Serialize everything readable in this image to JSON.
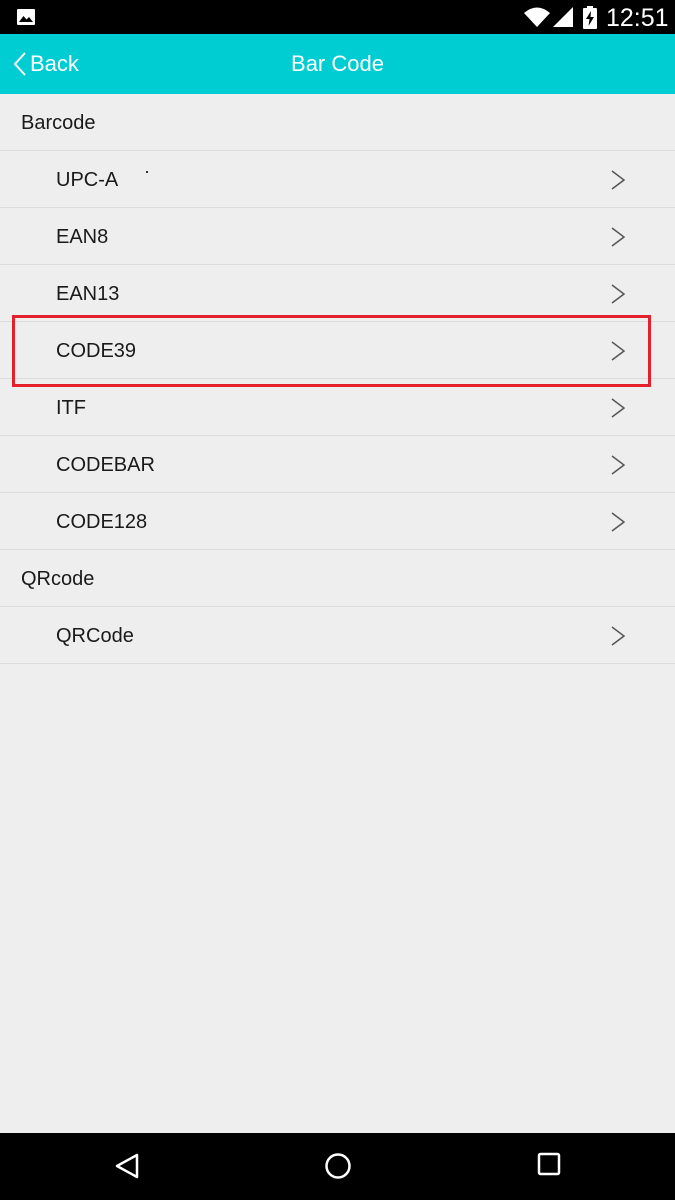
{
  "status_bar": {
    "time": "12:51",
    "icons": [
      "image-notification-icon",
      "wifi-icon",
      "cell-signal-icon",
      "battery-charging-icon"
    ]
  },
  "app_bar": {
    "back_label": "Back",
    "title": "Bar Code",
    "background_color": "#00cdd2"
  },
  "sections": [
    {
      "header": "Barcode",
      "items": [
        "UPC-A",
        "EAN8",
        "EAN13",
        "CODE39",
        "ITF",
        "CODEBAR",
        "CODE128"
      ]
    },
    {
      "header": "QRcode",
      "items": [
        "QRCode"
      ]
    }
  ],
  "highlighted_item": "CODE39",
  "highlight_color": "#e3202c",
  "nav_bar": {
    "icons": [
      "nav-back-icon",
      "nav-home-icon",
      "nav-recents-icon"
    ]
  }
}
